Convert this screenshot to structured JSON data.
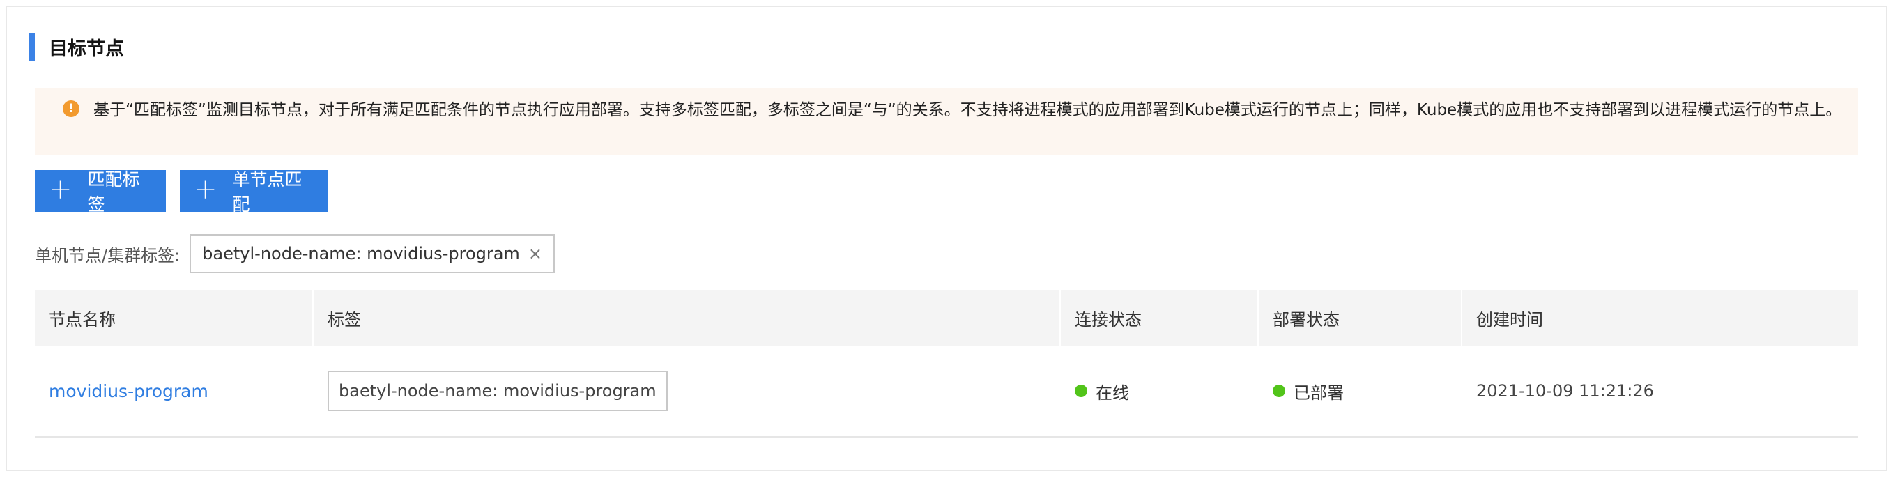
{
  "section": {
    "title": "目标节点"
  },
  "notice": {
    "icon": "warning-circle-icon",
    "icon_glyph": "!",
    "text": "基于“匹配标签”监测目标节点，对于所有满足匹配条件的节点执行应用部署。支持多标签匹配，多标签之间是“与”的关系。不支持将进程模式的应用部署到Kube模式运行的节点上；同样，Kube模式的应用也不支持部署到以进程模式运行的节点上。"
  },
  "buttons": {
    "match_label": "匹配标签",
    "single_node": "单节点匹配",
    "plus_glyph": "+"
  },
  "filter": {
    "label": "单机节点/集群标签:",
    "tag": "baetyl-node-name: movidius-program",
    "close_glyph": "×"
  },
  "table": {
    "columns": [
      "节点名称",
      "标签",
      "连接状态",
      "部署状态",
      "创建时间"
    ],
    "rows": [
      {
        "name": "movidius-program",
        "tag": "baetyl-node-name: movidius-program",
        "connection": "在线",
        "deployment": "已部署",
        "created": "2021-10-09 11:21:26"
      }
    ]
  },
  "colors": {
    "accent": "#2f7de1",
    "notice_bg": "#fdf6f0",
    "warning": "#f29a2e",
    "online": "#52c41a"
  }
}
